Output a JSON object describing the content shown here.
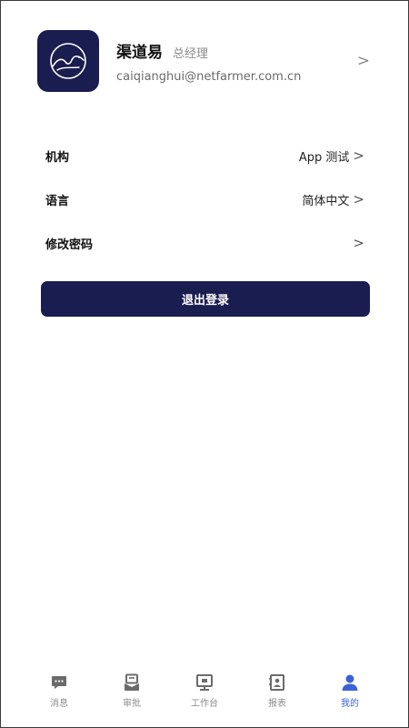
{
  "profile": {
    "name": "渠道易",
    "title": "总经理",
    "email": "caiqianghui@netfarmer.com.cn",
    "logo_icon": "camel-logo-icon",
    "chevron": ">"
  },
  "settings": [
    {
      "label": "机构",
      "value": "App 测试",
      "chevron": ">"
    },
    {
      "label": "语言",
      "value": "简体中文",
      "chevron": ">"
    },
    {
      "label": "修改密码",
      "value": "",
      "chevron": ">"
    }
  ],
  "logout_label": "退出登录",
  "nav": [
    {
      "label": "消息",
      "icon": "chat-bubble-icon",
      "active": false
    },
    {
      "label": "审批",
      "icon": "approval-icon",
      "active": false
    },
    {
      "label": "工作台",
      "icon": "workbench-icon",
      "active": false
    },
    {
      "label": "报表",
      "icon": "report-icon",
      "active": false
    },
    {
      "label": "我的",
      "icon": "person-icon",
      "active": true
    }
  ],
  "colors": {
    "brand": "#1a1d4f",
    "active_nav": "#3c63d6",
    "inactive_nav": "#8c8c8c"
  }
}
